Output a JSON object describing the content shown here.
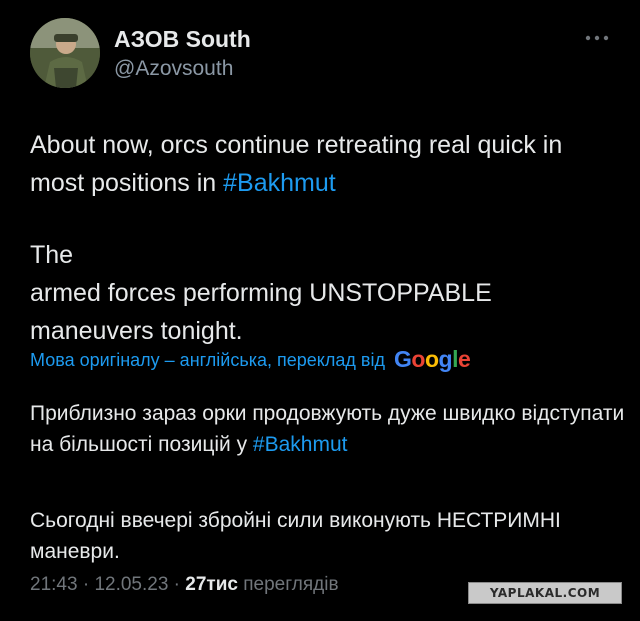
{
  "author": {
    "name": "АЗОВ South",
    "handle": "@Azovsouth"
  },
  "tweet": {
    "line1_text": "About now, orcs continue retreating real quick in most positions in ",
    "line1_hashtag": "#Bakhmut",
    "line2_text": "armed forces performing UNSTOPPABLE maneuvers tonight."
  },
  "translation": {
    "label": "Мова оригіналу – англійська, переклад від",
    "provider": "Google",
    "line1_text": "Приблизно зараз орки продовжують дуже швидко відступати на більшості позицій у ",
    "line1_hashtag": "#Bakhmut",
    "line2_text": "Сьогодні ввечері збройні сили виконують НЕСТРИМНІ маневри."
  },
  "meta": {
    "time": "21:43",
    "separator1": " · ",
    "date": "12.05.23",
    "separator2": " · ",
    "views_count": "27тис",
    "views_label": " переглядів"
  },
  "watermark": "YAPLAKAL.COM",
  "colors": {
    "background": "#000000",
    "text": "#e7e9ea",
    "secondary": "#71767b",
    "link": "#1d9bf0",
    "flag_blue": "#2f6fd6",
    "flag_yellow": "#f5cd1e"
  },
  "icons": {
    "more": "more-dots-icon",
    "flag": "ukraine-flag-icon"
  }
}
